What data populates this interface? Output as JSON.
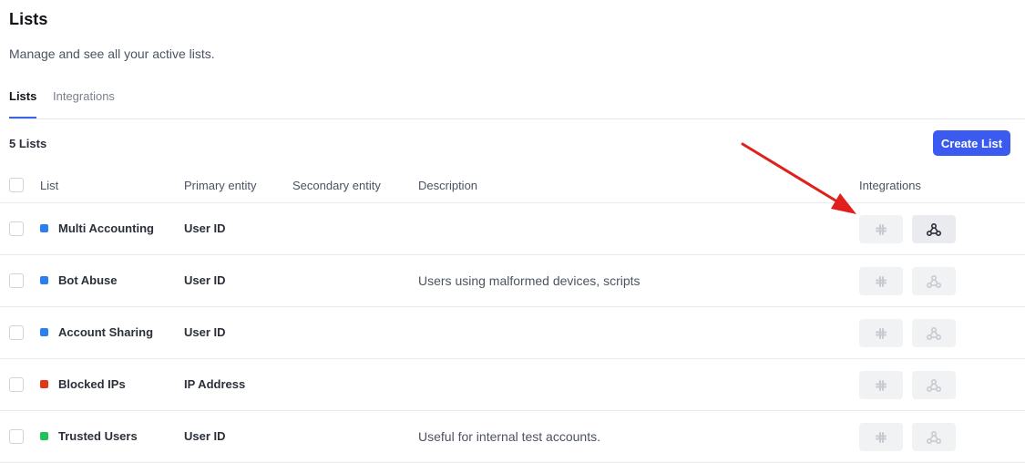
{
  "page": {
    "title": "Lists",
    "subtitle": "Manage and see all your active lists."
  },
  "tabs": [
    {
      "label": "Lists",
      "active": true
    },
    {
      "label": "Integrations",
      "active": false
    }
  ],
  "summary": {
    "count_label": "5 Lists",
    "create_button": "Create List"
  },
  "table": {
    "columns": [
      "List",
      "Primary entity",
      "Secondary entity",
      "Description",
      "Integrations"
    ],
    "rows": [
      {
        "name": "Multi Accounting",
        "color": "#2f7ef0",
        "primary": "User ID",
        "secondary": "",
        "description": "",
        "slack_enabled": false,
        "webhook_enabled": true
      },
      {
        "name": "Bot Abuse",
        "color": "#2f7ef0",
        "primary": "User ID",
        "secondary": "",
        "description": "Users using malformed devices, scripts",
        "slack_enabled": false,
        "webhook_enabled": false
      },
      {
        "name": "Account Sharing",
        "color": "#2f7ef0",
        "primary": "User ID",
        "secondary": "",
        "description": "",
        "slack_enabled": false,
        "webhook_enabled": false
      },
      {
        "name": "Blocked IPs",
        "color": "#e0391a",
        "primary": "IP Address",
        "secondary": "",
        "description": "",
        "slack_enabled": false,
        "webhook_enabled": false
      },
      {
        "name": "Trusted Users",
        "color": "#1fc35a",
        "primary": "User ID",
        "secondary": "",
        "description": "Useful for internal test accounts.",
        "slack_enabled": false,
        "webhook_enabled": false
      }
    ]
  },
  "icons": {
    "slack": "slack-icon",
    "webhook": "webhook-icon",
    "annotation": "red-arrow"
  },
  "colors": {
    "accent": "#3b5bf0",
    "annotation_arrow": "#e0201d"
  }
}
